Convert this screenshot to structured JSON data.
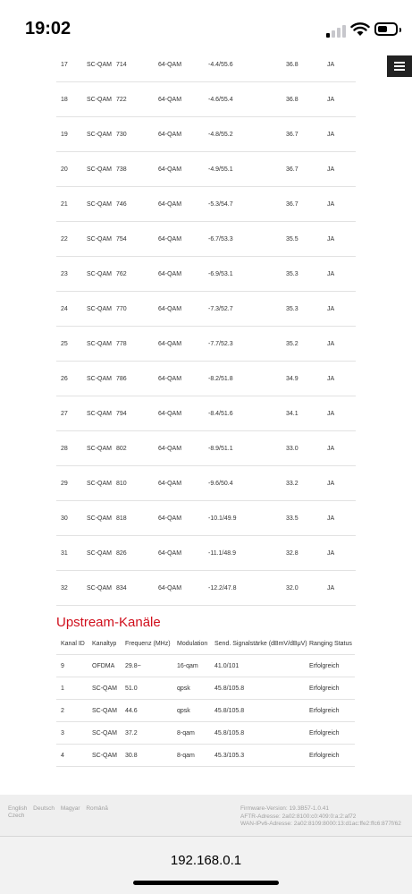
{
  "status_bar": {
    "time": "19:02"
  },
  "downstream": {
    "rows": [
      {
        "id": "17",
        "type": "SC-QAM",
        "freq": "714",
        "mod": "64-QAM",
        "power": "-4.4/55.6",
        "snr": "36.8",
        "locked": "JA"
      },
      {
        "id": "18",
        "type": "SC-QAM",
        "freq": "722",
        "mod": "64-QAM",
        "power": "-4.6/55.4",
        "snr": "36.8",
        "locked": "JA"
      },
      {
        "id": "19",
        "type": "SC-QAM",
        "freq": "730",
        "mod": "64-QAM",
        "power": "-4.8/55.2",
        "snr": "36.7",
        "locked": "JA"
      },
      {
        "id": "20",
        "type": "SC-QAM",
        "freq": "738",
        "mod": "64-QAM",
        "power": "-4.9/55.1",
        "snr": "36.7",
        "locked": "JA"
      },
      {
        "id": "21",
        "type": "SC-QAM",
        "freq": "746",
        "mod": "64-QAM",
        "power": "-5.3/54.7",
        "snr": "36.7",
        "locked": "JA"
      },
      {
        "id": "22",
        "type": "SC-QAM",
        "freq": "754",
        "mod": "64-QAM",
        "power": "-6.7/53.3",
        "snr": "35.5",
        "locked": "JA"
      },
      {
        "id": "23",
        "type": "SC-QAM",
        "freq": "762",
        "mod": "64-QAM",
        "power": "-6.9/53.1",
        "snr": "35.3",
        "locked": "JA"
      },
      {
        "id": "24",
        "type": "SC-QAM",
        "freq": "770",
        "mod": "64-QAM",
        "power": "-7.3/52.7",
        "snr": "35.3",
        "locked": "JA"
      },
      {
        "id": "25",
        "type": "SC-QAM",
        "freq": "778",
        "mod": "64-QAM",
        "power": "-7.7/52.3",
        "snr": "35.2",
        "locked": "JA"
      },
      {
        "id": "26",
        "type": "SC-QAM",
        "freq": "786",
        "mod": "64-QAM",
        "power": "-8.2/51.8",
        "snr": "34.9",
        "locked": "JA"
      },
      {
        "id": "27",
        "type": "SC-QAM",
        "freq": "794",
        "mod": "64-QAM",
        "power": "-8.4/51.6",
        "snr": "34.1",
        "locked": "JA"
      },
      {
        "id": "28",
        "type": "SC-QAM",
        "freq": "802",
        "mod": "64-QAM",
        "power": "-8.9/51.1",
        "snr": "33.0",
        "locked": "JA"
      },
      {
        "id": "29",
        "type": "SC-QAM",
        "freq": "810",
        "mod": "64-QAM",
        "power": "-9.6/50.4",
        "snr": "33.2",
        "locked": "JA"
      },
      {
        "id": "30",
        "type": "SC-QAM",
        "freq": "818",
        "mod": "64-QAM",
        "power": "-10.1/49.9",
        "snr": "33.5",
        "locked": "JA"
      },
      {
        "id": "31",
        "type": "SC-QAM",
        "freq": "826",
        "mod": "64-QAM",
        "power": "-11.1/48.9",
        "snr": "32.8",
        "locked": "JA"
      },
      {
        "id": "32",
        "type": "SC-QAM",
        "freq": "834",
        "mod": "64-QAM",
        "power": "-12.2/47.8",
        "snr": "32.0",
        "locked": "JA"
      }
    ]
  },
  "upstream": {
    "title": "Upstream-Kanäle",
    "headers": {
      "channel_id": "Kanal ID",
      "channel_type": "Kanaltyp",
      "frequency": "Frequenz (MHz)",
      "modulation": "Modulation",
      "power": "Send. Signalstärke (dBmV/dBμV)",
      "ranging": "Ranging Status"
    },
    "rows": [
      {
        "id": "9",
        "type": "OFDMA",
        "freq": "29.8~",
        "mod": "16-qam",
        "power": "41.0/101",
        "status": "Erfolgreich"
      },
      {
        "id": "1",
        "type": "SC-QAM",
        "freq": "51.0",
        "mod": "qpsk",
        "power": "45.8/105.8",
        "status": "Erfolgreich"
      },
      {
        "id": "2",
        "type": "SC-QAM",
        "freq": "44.6",
        "mod": "qpsk",
        "power": "45.8/105.8",
        "status": "Erfolgreich"
      },
      {
        "id": "3",
        "type": "SC-QAM",
        "freq": "37.2",
        "mod": "8-qam",
        "power": "45.8/105.8",
        "status": "Erfolgreich"
      },
      {
        "id": "4",
        "type": "SC-QAM",
        "freq": "30.8",
        "mod": "8-qam",
        "power": "45.3/105.3",
        "status": "Erfolgreich"
      }
    ]
  },
  "footer": {
    "languages": [
      "English",
      "Deutsch",
      "Magyar",
      "Română",
      "Czech"
    ],
    "firmware": "Firmware-Version: 19.3B57-1.0.41",
    "aftr": "AFTR-Adresse: 2a02:8100:c0:409:0:a:2:af72",
    "wan_ipv6": "WAN-IPv6-Adresse: 2a02:8109:8000:13:d1ac:ffe2:ffc6:877f/62"
  },
  "browser": {
    "url": "192.168.0.1"
  },
  "colors": {
    "accent": "#d00f1c",
    "menu_bg": "#222222"
  },
  "icons": {
    "menu": "hamburger-icon",
    "signal": "cellular-signal-icon",
    "wifi": "wifi-icon",
    "battery": "battery-icon"
  }
}
